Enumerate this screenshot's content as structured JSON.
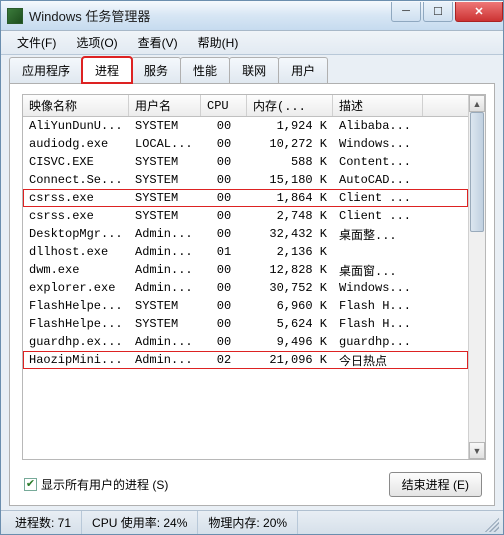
{
  "window": {
    "title": "Windows 任务管理器"
  },
  "menu": {
    "file": "文件(F)",
    "options": "选项(O)",
    "view": "查看(V)",
    "help": "帮助(H)"
  },
  "tabs": {
    "applications": "应用程序",
    "processes": "进程",
    "services": "服务",
    "performance": "性能",
    "networking": "联网",
    "users": "用户"
  },
  "columns": {
    "image_name": "映像名称",
    "user_name": "用户名",
    "cpu": "CPU",
    "memory": "内存(...",
    "description": "描述"
  },
  "rows": [
    {
      "hl": "",
      "name": "AliYunDunU...",
      "user": "SYSTEM",
      "cpu": "00",
      "mem": "1,924 K",
      "desc": "Alibaba..."
    },
    {
      "hl": "",
      "name": "audiodg.exe",
      "user": "LOCAL...",
      "cpu": "00",
      "mem": "10,272 K",
      "desc": "Windows..."
    },
    {
      "hl": "",
      "name": "CISVC.EXE",
      "user": "SYSTEM",
      "cpu": "00",
      "mem": "588 K",
      "desc": "Content..."
    },
    {
      "hl": "",
      "name": "Connect.Se...",
      "user": "SYSTEM",
      "cpu": "00",
      "mem": "15,180 K",
      "desc": "AutoCAD..."
    },
    {
      "hl": "hl1",
      "name": "csrss.exe",
      "user": "SYSTEM",
      "cpu": "00",
      "mem": "1,864 K",
      "desc": "Client ..."
    },
    {
      "hl": "",
      "name": "csrss.exe",
      "user": "SYSTEM",
      "cpu": "00",
      "mem": "2,748 K",
      "desc": "Client ..."
    },
    {
      "hl": "",
      "name": "DesktopMgr...",
      "user": "Admin...",
      "cpu": "00",
      "mem": "32,432 K",
      "desc": "桌面整..."
    },
    {
      "hl": "",
      "name": "dllhost.exe",
      "user": "Admin...",
      "cpu": "01",
      "mem": "2,136 K",
      "desc": ""
    },
    {
      "hl": "",
      "name": "dwm.exe",
      "user": "Admin...",
      "cpu": "00",
      "mem": "12,828 K",
      "desc": "桌面窗..."
    },
    {
      "hl": "",
      "name": "explorer.exe",
      "user": "Admin...",
      "cpu": "00",
      "mem": "30,752 K",
      "desc": "Windows..."
    },
    {
      "hl": "",
      "name": "FlashHelpe...",
      "user": "SYSTEM",
      "cpu": "00",
      "mem": "6,960 K",
      "desc": "Flash H..."
    },
    {
      "hl": "",
      "name": "FlashHelpe...",
      "user": "SYSTEM",
      "cpu": "00",
      "mem": "5,624 K",
      "desc": "Flash H..."
    },
    {
      "hl": "",
      "name": "guardhp.ex...",
      "user": "Admin...",
      "cpu": "00",
      "mem": "9,496 K",
      "desc": "guardhp..."
    },
    {
      "hl": "hl2",
      "name": "HaozipMini...",
      "user": "Admin...",
      "cpu": "02",
      "mem": "21,096 K",
      "desc": "今日热点"
    }
  ],
  "bottom": {
    "show_all_users": "显示所有用户的进程 (S)",
    "end_process": "结束进程 (E)"
  },
  "status": {
    "process_count_label": "进程数: 71",
    "cpu_usage_label": "CPU 使用率: 24%",
    "phys_mem_label": "物理内存: 20%"
  }
}
